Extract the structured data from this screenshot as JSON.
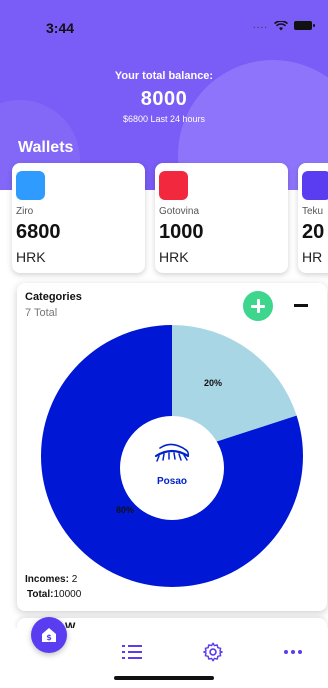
{
  "status": {
    "time": "3:44",
    "signal": "...."
  },
  "header": {
    "balance_label": "Your total balance:",
    "balance_amount": "8000",
    "balance_sub": "$6800 Last 24 hours",
    "wallets_title": "Wallets"
  },
  "wallets": [
    {
      "name": "Ziro",
      "value": "6800",
      "currency": "HRK",
      "color": "#2f9bff"
    },
    {
      "name": "Gotovina",
      "value": "1000",
      "currency": "HRK",
      "color": "#f2293e"
    },
    {
      "name": "Teku",
      "value": "20",
      "currency": "HR",
      "color": "#5a3df0"
    }
  ],
  "categories": {
    "title": "Categories",
    "total_count": "7 Total",
    "center_label": "Posao",
    "incomes_label": "Incomes:",
    "incomes_value": "2",
    "total_label": "Total:",
    "total_value": "10000",
    "pie": [
      {
        "label": "80%",
        "value": 80,
        "color": "#0018d6"
      },
      {
        "label": "20%",
        "value": 20,
        "color": "#a9d6e5"
      }
    ]
  },
  "next_card": {
    "title": "W"
  },
  "tabs": {
    "home_icon": "home-money-icon",
    "list_icon": "list-icon",
    "settings_icon": "gear-icon",
    "more_icon": "more-icon"
  },
  "colors": {
    "accent": "#7a5cf6",
    "add": "#3dd68c",
    "tab_icon": "#5a3df0"
  }
}
